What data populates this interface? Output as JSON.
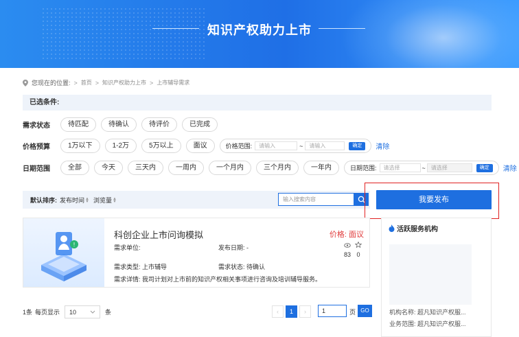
{
  "banner": {
    "title": "知识产权助力上市"
  },
  "breadcrumb": {
    "prefix": "您现在的位置:",
    "items": [
      "首页",
      "知识产权助力上市",
      "上市辅导需求"
    ],
    "sep": ">"
  },
  "filters": {
    "selected_label": "已选条件:",
    "status": {
      "label": "需求状态",
      "options": [
        "待匹配",
        "待确认",
        "待评价",
        "已完成"
      ]
    },
    "budget": {
      "label": "价格预算",
      "options": [
        "1万以下",
        "1-2万",
        "5万以上",
        "面议"
      ],
      "range_label": "价格范围:",
      "min_placeholder": "请输入",
      "max_placeholder": "请输入",
      "tilde": "~",
      "confirm": "确定",
      "clear": "清除"
    },
    "date": {
      "label": "日期范围",
      "options": [
        "全部",
        "今天",
        "三天内",
        "一周内",
        "一个月内",
        "三个月内",
        "一年内"
      ],
      "range_label": "日期范围:",
      "start_placeholder": "请选择",
      "end_placeholder": "请选择",
      "tilde": "~",
      "confirm": "确定",
      "clear": "清除"
    }
  },
  "sort": {
    "label": "默认排序:",
    "by_time": "发布时间",
    "by_views": "浏览量"
  },
  "search": {
    "placeholder": "输入搜索内容"
  },
  "publish_button": "我要发布",
  "listing": {
    "title": "科创企业上市问询模拟",
    "price": "价格: 面议",
    "unit_label": "需求单位:",
    "unit_value": "",
    "date_label": "发布日期:",
    "date_value": "-",
    "views": "83",
    "likes": "0",
    "type_label": "需求类型:",
    "type_value": "上市辅导",
    "status_label": "需求状态:",
    "status_value": "待确认",
    "detail_label": "需求详情:",
    "detail_value": "我司计划对上市前的知识产权相关事项进行咨询及培训辅导服务。"
  },
  "sidebar": {
    "title": "活跃服务机构",
    "org_name_label": "机构名称:",
    "org_name": "超凡知识产权服...",
    "scope_label": "业务范围:",
    "scope": "超凡知识产权服..."
  },
  "pager": {
    "total": "1条",
    "per_page_label": "每页显示",
    "per_page": "10",
    "unit": "条",
    "current_page": "1",
    "goto_value": "1",
    "page_unit": "页",
    "go": "GO"
  },
  "colors": {
    "primary": "#1e6fe0",
    "price": "#e03a3a",
    "highlight_box": "#e02020"
  }
}
